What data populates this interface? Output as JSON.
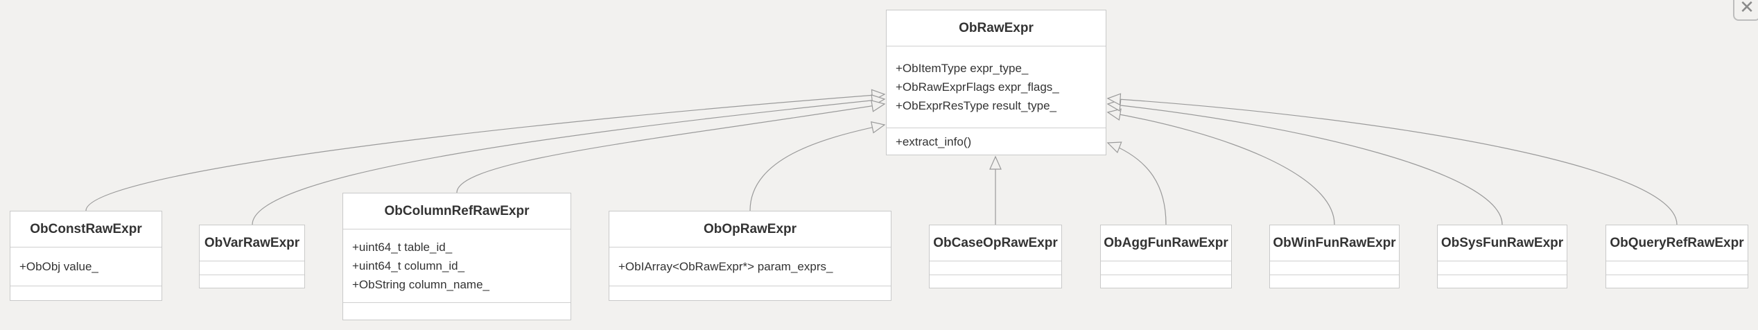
{
  "diagram": {
    "type": "uml-class",
    "root": {
      "id": "root",
      "name": "ObRawExpr",
      "attributes": [
        "+ObItemType expr_type_",
        "+ObRawExprFlags expr_flags_",
        "+ObExprResType result_type_"
      ],
      "methods": [
        "+extract_info()"
      ]
    },
    "children": [
      {
        "id": "c0",
        "name": "ObConstRawExpr",
        "attributes": [
          "+ObObj value_"
        ],
        "methods": []
      },
      {
        "id": "c1",
        "name": "ObVarRawExpr",
        "attributes": [],
        "methods": []
      },
      {
        "id": "c2",
        "name": "ObColumnRefRawExpr",
        "attributes": [
          "+uint64_t table_id_",
          "+uint64_t column_id_",
          "+ObString column_name_"
        ],
        "methods": []
      },
      {
        "id": "c3",
        "name": "ObOpRawExpr",
        "attributes": [
          "+ObIArray<ObRawExpr*> param_exprs_"
        ],
        "methods": []
      },
      {
        "id": "c4",
        "name": "ObCaseOpRawExpr",
        "attributes": [],
        "methods": []
      },
      {
        "id": "c5",
        "name": "ObAggFunRawExpr",
        "attributes": [],
        "methods": []
      },
      {
        "id": "c6",
        "name": "ObWinFunRawExpr",
        "attributes": [],
        "methods": []
      },
      {
        "id": "c7",
        "name": "ObSysFunRawExpr",
        "attributes": [],
        "methods": []
      },
      {
        "id": "c8",
        "name": "ObQueryRefRawExpr",
        "attributes": [],
        "methods": []
      }
    ],
    "relation": "inheritance"
  },
  "colors": {
    "background": "#f2f1ef",
    "box_fill": "#ffffff",
    "box_border": "#c9c9c9",
    "edge": "#9a9a9a",
    "text": "#333333"
  },
  "controls": {
    "close_icon": "close-icon",
    "close_glyph": "✕"
  }
}
